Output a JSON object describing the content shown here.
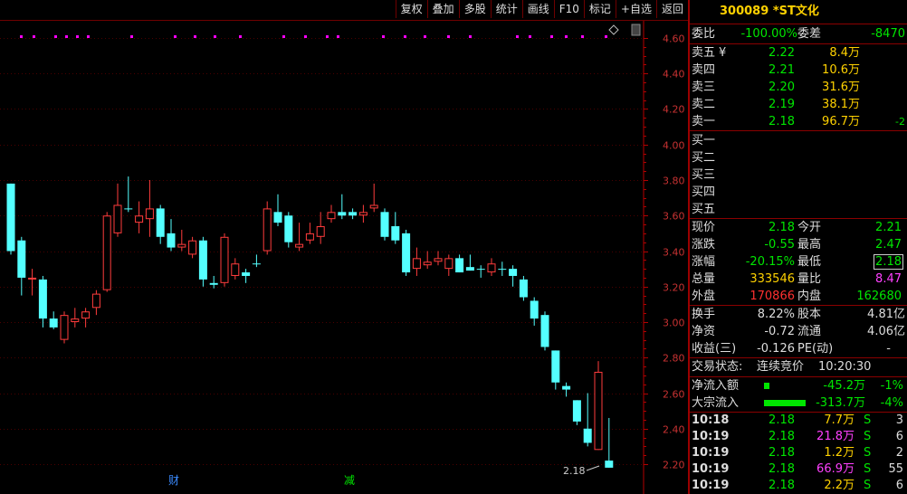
{
  "toolbar": {
    "buttons": [
      "复权",
      "叠加",
      "多股",
      "统计",
      "画线",
      "F10",
      "标记",
      "+自选",
      "返回"
    ]
  },
  "chart_data": {
    "type": "candlestick",
    "y_ticks": [
      "4.60",
      "4.40",
      "4.20",
      "4.00",
      "3.80",
      "3.60",
      "3.40",
      "3.20",
      "3.00",
      "2.80",
      "2.60",
      "2.40",
      "2.20"
    ],
    "ylim": [
      2.16,
      4.64
    ],
    "last_price_label": "2.18",
    "markers": [
      "财",
      "减"
    ],
    "candles": [
      {
        "o": 3.78,
        "h": 3.78,
        "l": 3.38,
        "c": 3.4
      },
      {
        "o": 3.46,
        "h": 3.48,
        "l": 3.15,
        "c": 3.25
      },
      {
        "o": 3.24,
        "h": 3.3,
        "l": 3.15,
        "c": 3.25
      },
      {
        "o": 3.24,
        "h": 3.26,
        "l": 2.97,
        "c": 3.02
      },
      {
        "o": 3.02,
        "h": 3.06,
        "l": 2.96,
        "c": 2.97
      },
      {
        "o": 2.9,
        "h": 3.06,
        "l": 2.88,
        "c": 3.04
      },
      {
        "o": 3.0,
        "h": 3.08,
        "l": 2.97,
        "c": 3.02
      },
      {
        "o": 3.02,
        "h": 3.08,
        "l": 2.97,
        "c": 3.06
      },
      {
        "o": 3.08,
        "h": 3.18,
        "l": 3.04,
        "c": 3.16
      },
      {
        "o": 3.18,
        "h": 3.62,
        "l": 3.17,
        "c": 3.6
      },
      {
        "o": 3.5,
        "h": 3.78,
        "l": 3.48,
        "c": 3.66
      },
      {
        "o": 3.64,
        "h": 3.82,
        "l": 3.62,
        "c": 3.64
      },
      {
        "o": 3.56,
        "h": 3.68,
        "l": 3.5,
        "c": 3.6
      },
      {
        "o": 3.58,
        "h": 3.8,
        "l": 3.48,
        "c": 3.64
      },
      {
        "o": 3.64,
        "h": 3.66,
        "l": 3.44,
        "c": 3.48
      },
      {
        "o": 3.5,
        "h": 3.58,
        "l": 3.4,
        "c": 3.42
      },
      {
        "o": 3.42,
        "h": 3.52,
        "l": 3.4,
        "c": 3.44
      },
      {
        "o": 3.38,
        "h": 3.48,
        "l": 3.36,
        "c": 3.46
      },
      {
        "o": 3.46,
        "h": 3.48,
        "l": 3.2,
        "c": 3.24
      },
      {
        "o": 3.22,
        "h": 3.26,
        "l": 3.19,
        "c": 3.21
      },
      {
        "o": 3.22,
        "h": 3.5,
        "l": 3.2,
        "c": 3.48
      },
      {
        "o": 3.26,
        "h": 3.36,
        "l": 3.24,
        "c": 3.33
      },
      {
        "o": 3.28,
        "h": 3.3,
        "l": 3.22,
        "c": 3.26
      },
      {
        "o": 3.33,
        "h": 3.38,
        "l": 3.31,
        "c": 3.33
      },
      {
        "o": 3.4,
        "h": 3.68,
        "l": 3.38,
        "c": 3.64
      },
      {
        "o": 3.62,
        "h": 3.72,
        "l": 3.54,
        "c": 3.56
      },
      {
        "o": 3.6,
        "h": 3.62,
        "l": 3.42,
        "c": 3.45
      },
      {
        "o": 3.42,
        "h": 3.56,
        "l": 3.4,
        "c": 3.44
      },
      {
        "o": 3.46,
        "h": 3.56,
        "l": 3.44,
        "c": 3.5
      },
      {
        "o": 3.48,
        "h": 3.62,
        "l": 3.44,
        "c": 3.54
      },
      {
        "o": 3.58,
        "h": 3.66,
        "l": 3.56,
        "c": 3.62
      },
      {
        "o": 3.62,
        "h": 3.72,
        "l": 3.58,
        "c": 3.6
      },
      {
        "o": 3.62,
        "h": 3.64,
        "l": 3.58,
        "c": 3.6
      },
      {
        "o": 3.6,
        "h": 3.66,
        "l": 3.56,
        "c": 3.62
      },
      {
        "o": 3.64,
        "h": 3.78,
        "l": 3.62,
        "c": 3.66
      },
      {
        "o": 3.62,
        "h": 3.64,
        "l": 3.46,
        "c": 3.48
      },
      {
        "o": 3.54,
        "h": 3.62,
        "l": 3.44,
        "c": 3.46
      },
      {
        "o": 3.5,
        "h": 3.52,
        "l": 3.26,
        "c": 3.28
      },
      {
        "o": 3.3,
        "h": 3.42,
        "l": 3.26,
        "c": 3.36
      },
      {
        "o": 3.32,
        "h": 3.4,
        "l": 3.3,
        "c": 3.34
      },
      {
        "o": 3.34,
        "h": 3.4,
        "l": 3.32,
        "c": 3.36
      },
      {
        "o": 3.3,
        "h": 3.38,
        "l": 3.26,
        "c": 3.36
      },
      {
        "o": 3.36,
        "h": 3.38,
        "l": 3.28,
        "c": 3.28
      },
      {
        "o": 3.31,
        "h": 3.38,
        "l": 3.29,
        "c": 3.29
      },
      {
        "o": 3.3,
        "h": 3.32,
        "l": 3.25,
        "c": 3.3
      },
      {
        "o": 3.28,
        "h": 3.36,
        "l": 3.26,
        "c": 3.33
      },
      {
        "o": 3.3,
        "h": 3.34,
        "l": 3.26,
        "c": 3.3
      },
      {
        "o": 3.3,
        "h": 3.32,
        "l": 3.2,
        "c": 3.26
      },
      {
        "o": 3.24,
        "h": 3.26,
        "l": 3.12,
        "c": 3.14
      },
      {
        "o": 3.12,
        "h": 3.14,
        "l": 2.98,
        "c": 3.02
      },
      {
        "o": 3.04,
        "h": 3.06,
        "l": 2.84,
        "c": 2.86
      },
      {
        "o": 2.84,
        "h": 2.84,
        "l": 2.62,
        "c": 2.66
      },
      {
        "o": 2.64,
        "h": 2.66,
        "l": 2.58,
        "c": 2.62
      },
      {
        "o": 2.56,
        "h": 2.56,
        "l": 2.42,
        "c": 2.44
      },
      {
        "o": 2.4,
        "h": 2.6,
        "l": 2.3,
        "c": 2.32
      },
      {
        "o": 2.28,
        "h": 2.78,
        "l": 2.28,
        "c": 2.72
      },
      {
        "o": 2.22,
        "h": 2.46,
        "l": 2.18,
        "c": 2.18
      }
    ]
  },
  "quote": {
    "code": "300089",
    "name": "*ST文化",
    "weibi_label": "委比",
    "weibi": "-100.00%",
    "weicha_label": "委差",
    "weicha": "-8470",
    "sells": [
      {
        "label": "卖五",
        "mark": "¥",
        "price": "2.22",
        "vol": "8.4万",
        "extra": ""
      },
      {
        "label": "卖四",
        "mark": "",
        "price": "2.21",
        "vol": "10.6万",
        "extra": ""
      },
      {
        "label": "卖三",
        "mark": "",
        "price": "2.20",
        "vol": "31.6万",
        "extra": ""
      },
      {
        "label": "卖二",
        "mark": "",
        "price": "2.19",
        "vol": "38.1万",
        "extra": ""
      },
      {
        "label": "卖一",
        "mark": "",
        "price": "2.18",
        "vol": "96.7万",
        "extra": "-2"
      }
    ],
    "buys": [
      "买一",
      "买二",
      "买三",
      "买四",
      "买五"
    ],
    "stats": [
      {
        "l1": "现价",
        "v1": "2.18",
        "l2": "今开",
        "v2": "2.21"
      },
      {
        "l1": "涨跌",
        "v1": "-0.55",
        "l2": "最高",
        "v2": "2.47"
      },
      {
        "l1": "涨幅",
        "v1": "-20.15%",
        "l2": "最低",
        "v2": "2.18"
      },
      {
        "l1": "总量",
        "v1": "333546",
        "l2": "量比",
        "v2": "8.47"
      },
      {
        "l1": "外盘",
        "v1": "170866",
        "l2": "内盘",
        "v2": "162680"
      }
    ],
    "fund": [
      {
        "l1": "换手",
        "v1": "8.22%",
        "l2": "股本",
        "v2": "4.81亿"
      },
      {
        "l1": "净资",
        "v1": "-0.72",
        "l2": "流通",
        "v2": "4.06亿"
      },
      {
        "l1": "收益(三)",
        "v1": "-0.126",
        "l2": "PE(动)",
        "v2": "-"
      }
    ],
    "status_label": "交易状态:",
    "status": "连续竞价",
    "time": "10:20:30",
    "netflow_label": "净流入额",
    "netflow": "-45.2万",
    "netflow_pct": "-1%",
    "block_label": "大宗流入",
    "block": "-313.7万",
    "block_pct": "-4%",
    "ticks": [
      {
        "t": "10:18",
        "p": "2.18",
        "v": "7.7万",
        "s": "S",
        "n": "3",
        "vc": "yellow"
      },
      {
        "t": "10:19",
        "p": "2.18",
        "v": "21.8万",
        "s": "S",
        "n": "6",
        "vc": "magenta"
      },
      {
        "t": "10:19",
        "p": "2.18",
        "v": "1.2万",
        "s": "S",
        "n": "2",
        "vc": "yellow"
      },
      {
        "t": "10:19",
        "p": "2.18",
        "v": "66.9万",
        "s": "S",
        "n": "55",
        "vc": "magenta"
      },
      {
        "t": "10:19",
        "p": "2.18",
        "v": "2.2万",
        "s": "S",
        "n": "6",
        "vc": "yellow"
      }
    ]
  }
}
